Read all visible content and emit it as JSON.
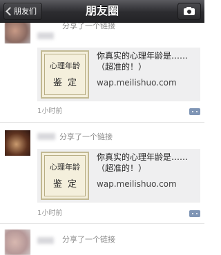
{
  "navbar": {
    "back_label": "朋友们",
    "title": "朋友圈"
  },
  "posts": [
    {
      "action": "分享了一个链接",
      "link_title": "你真实的心理年龄是……（超准的！）",
      "link_url": "wap.meilishuo.com",
      "thumb_line1": "心理年龄",
      "thumb_line2": "鉴定",
      "time": "1小时前"
    },
    {
      "action": "分享了一个链接",
      "link_title": "你真实的心理年龄是……（超准的！）",
      "link_url": "wap.meilishuo.com",
      "thumb_line1": "心理年龄",
      "thumb_line2": "鉴定",
      "time": "1小时前"
    },
    {
      "action": "分享了一个链接"
    }
  ],
  "icons": {
    "back": "chevron-left-icon",
    "camera": "camera-icon",
    "comment": "comment-icon"
  },
  "colors": {
    "navbar": "#2c2c30",
    "card_bg": "#efeff0",
    "comment_button": "#7f95b5",
    "muted_text": "#8c8c8c"
  }
}
